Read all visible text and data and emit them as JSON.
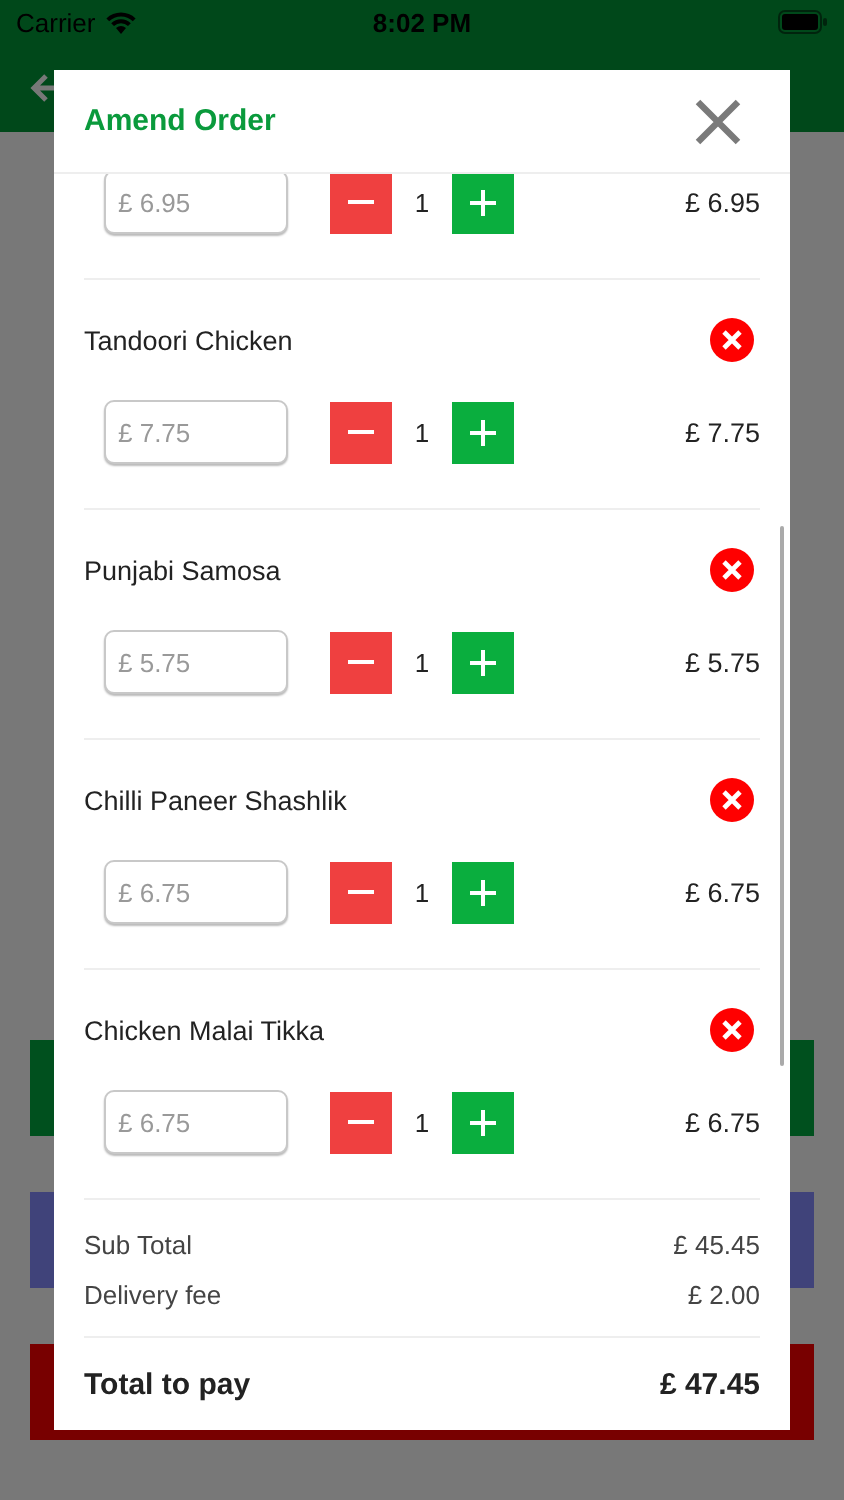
{
  "status_bar": {
    "carrier": "Carrier",
    "time": "8:02 PM"
  },
  "background_buttons": [
    {
      "color": "#00501e"
    },
    {
      "color": "#40437a"
    },
    {
      "color": "#780000"
    }
  ],
  "modal": {
    "title": "Amend Order",
    "items": [
      {
        "price": "£ 6.95",
        "quantity": "1",
        "total": "£ 6.95"
      },
      {
        "name": "Tandoori Chicken",
        "price": "£ 7.75",
        "quantity": "1",
        "total": "£ 7.75"
      },
      {
        "name": "Punjabi Samosa",
        "price": "£ 5.75",
        "quantity": "1",
        "total": "£ 5.75"
      },
      {
        "name": "Chilli Paneer Shashlik",
        "price": "£ 6.75",
        "quantity": "1",
        "total": "£ 6.75"
      },
      {
        "name": "Chicken Malai Tikka",
        "price": "£ 6.75",
        "quantity": "1",
        "total": "£ 6.75"
      }
    ],
    "summary": [
      {
        "label": "Sub Total",
        "value": "£ 45.45"
      },
      {
        "label": "Delivery fee",
        "value": "£ 2.00"
      }
    ],
    "total": {
      "label": "Total to pay",
      "value": "£ 47.45"
    }
  }
}
